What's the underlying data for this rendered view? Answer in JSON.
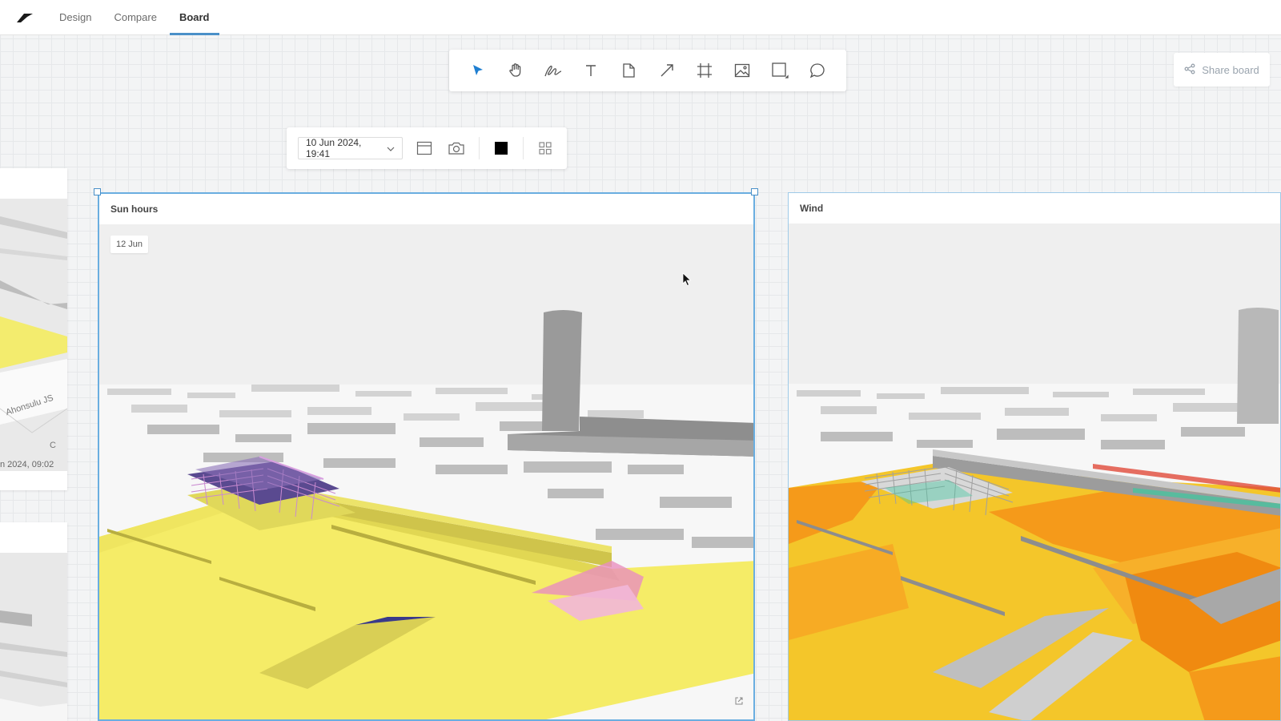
{
  "nav": {
    "logo_icon": "autodesk-logo-icon",
    "tabs": [
      {
        "label": "Design",
        "active": false
      },
      {
        "label": "Compare",
        "active": false
      },
      {
        "label": "Board",
        "active": true
      }
    ]
  },
  "toolbar": {
    "tools": [
      "select-arrow-icon",
      "hand-pan-icon",
      "freehand-draw-icon",
      "text-icon",
      "sticky-note-icon",
      "arrow-line-icon",
      "frame-icon",
      "image-icon",
      "shape-icon",
      "comment-icon"
    ],
    "active_tool_color": "#1f7fd1"
  },
  "share": {
    "label": "Share board",
    "icon": "share-icon"
  },
  "context_bar": {
    "date_value": "10 Jun 2024, 19:41",
    "icons": [
      "layout-icon",
      "camera-icon",
      "color-swatch-icon",
      "grid-icon"
    ],
    "swatch_color": "#000000"
  },
  "left_cards": {
    "caption": "n 2024, 09:02",
    "street_label": "Ahonsulu JS",
    "letter": "C"
  },
  "cards": {
    "sun": {
      "title": "Sun hours",
      "date_chip": "12 Jun"
    },
    "wind": {
      "title": "Wind"
    }
  },
  "colors": {
    "selection": "#6aaee0",
    "sun_surface": "#f6ee6a",
    "wind_orange": "#f59a1a",
    "wind_yellow": "#f4c62a"
  }
}
